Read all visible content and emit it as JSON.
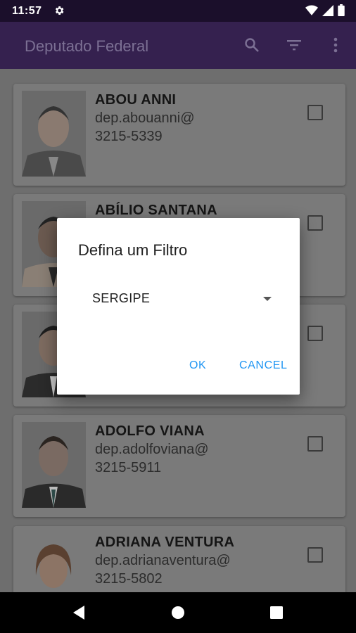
{
  "status": {
    "time": "11:57"
  },
  "appbar": {
    "title": "Deputado Federal"
  },
  "deputies": [
    {
      "name": "ABOU ANNI",
      "email": "dep.abouanni@",
      "phone": "3215-5339"
    },
    {
      "name": "ABÍLIO SANTANA",
      "email": "",
      "phone": ""
    },
    {
      "name": "",
      "email": "",
      "phone": ""
    },
    {
      "name": "ADOLFO VIANA",
      "email": "dep.adolfoviana@",
      "phone": "3215-5911"
    },
    {
      "name": "ADRIANA VENTURA",
      "email": "dep.adrianaventura@",
      "phone": "3215-5802"
    }
  ],
  "dialog": {
    "title": "Defina um Filtro",
    "selected": "SERGIPE",
    "ok_label": "OK",
    "cancel_label": "CANCEL"
  },
  "colors": {
    "accent": "#2196f3",
    "appbar": "#35214f"
  }
}
